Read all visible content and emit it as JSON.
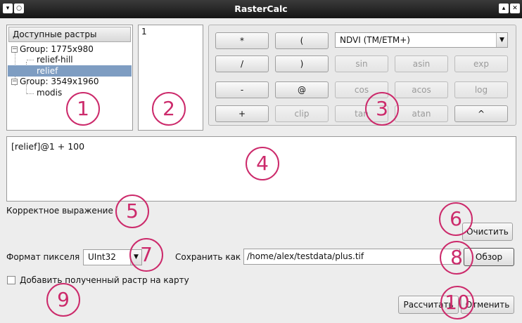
{
  "window": {
    "title": "RasterCalc",
    "menu_icon": "chevron-down-icon",
    "pin_icon": "circle-icon",
    "max_icon": "chevron-up-icon",
    "close_icon": "close-icon"
  },
  "rasters": {
    "header": "Доступные растры",
    "items": [
      {
        "label": "Group: 1775x980",
        "expander": "−"
      },
      {
        "label": "relief-hill"
      },
      {
        "label": "relief"
      },
      {
        "label": "Group: 3549x1960",
        "expander": "−"
      },
      {
        "label": "modis"
      }
    ]
  },
  "bands": {
    "items": [
      "1"
    ]
  },
  "operators": {
    "row1": [
      "*",
      "("
    ],
    "row2": [
      "/",
      ")"
    ],
    "row3": [
      "-",
      "@"
    ],
    "row4": [
      "+",
      "clip"
    ],
    "preset": "NDVI (TM/ETM+)",
    "functions": [
      "sin",
      "asin",
      "exp",
      "cos",
      "acos",
      "log",
      "tan",
      "atan",
      "^"
    ]
  },
  "expression": "[relief]@1 + 100",
  "status": "Корректное выражение",
  "clear_label": "Очистить",
  "pixel_format": {
    "label": "Формат пикселя",
    "value": "UInt32"
  },
  "save": {
    "label": "Сохранить как",
    "path": "/home/alex/testdata/plus.tif",
    "browse_label": "Обзор"
  },
  "add_to_map_label": "Добавить полученный растр на карту",
  "calculate_label": "Рассчитать",
  "cancel_label": "Отменить",
  "markers": [
    "1",
    "2",
    "3",
    "4",
    "5",
    "6",
    "7",
    "8",
    "9",
    "10"
  ],
  "colors": {
    "marker": "#cc2a6b",
    "selection": "#7e9dc2"
  }
}
